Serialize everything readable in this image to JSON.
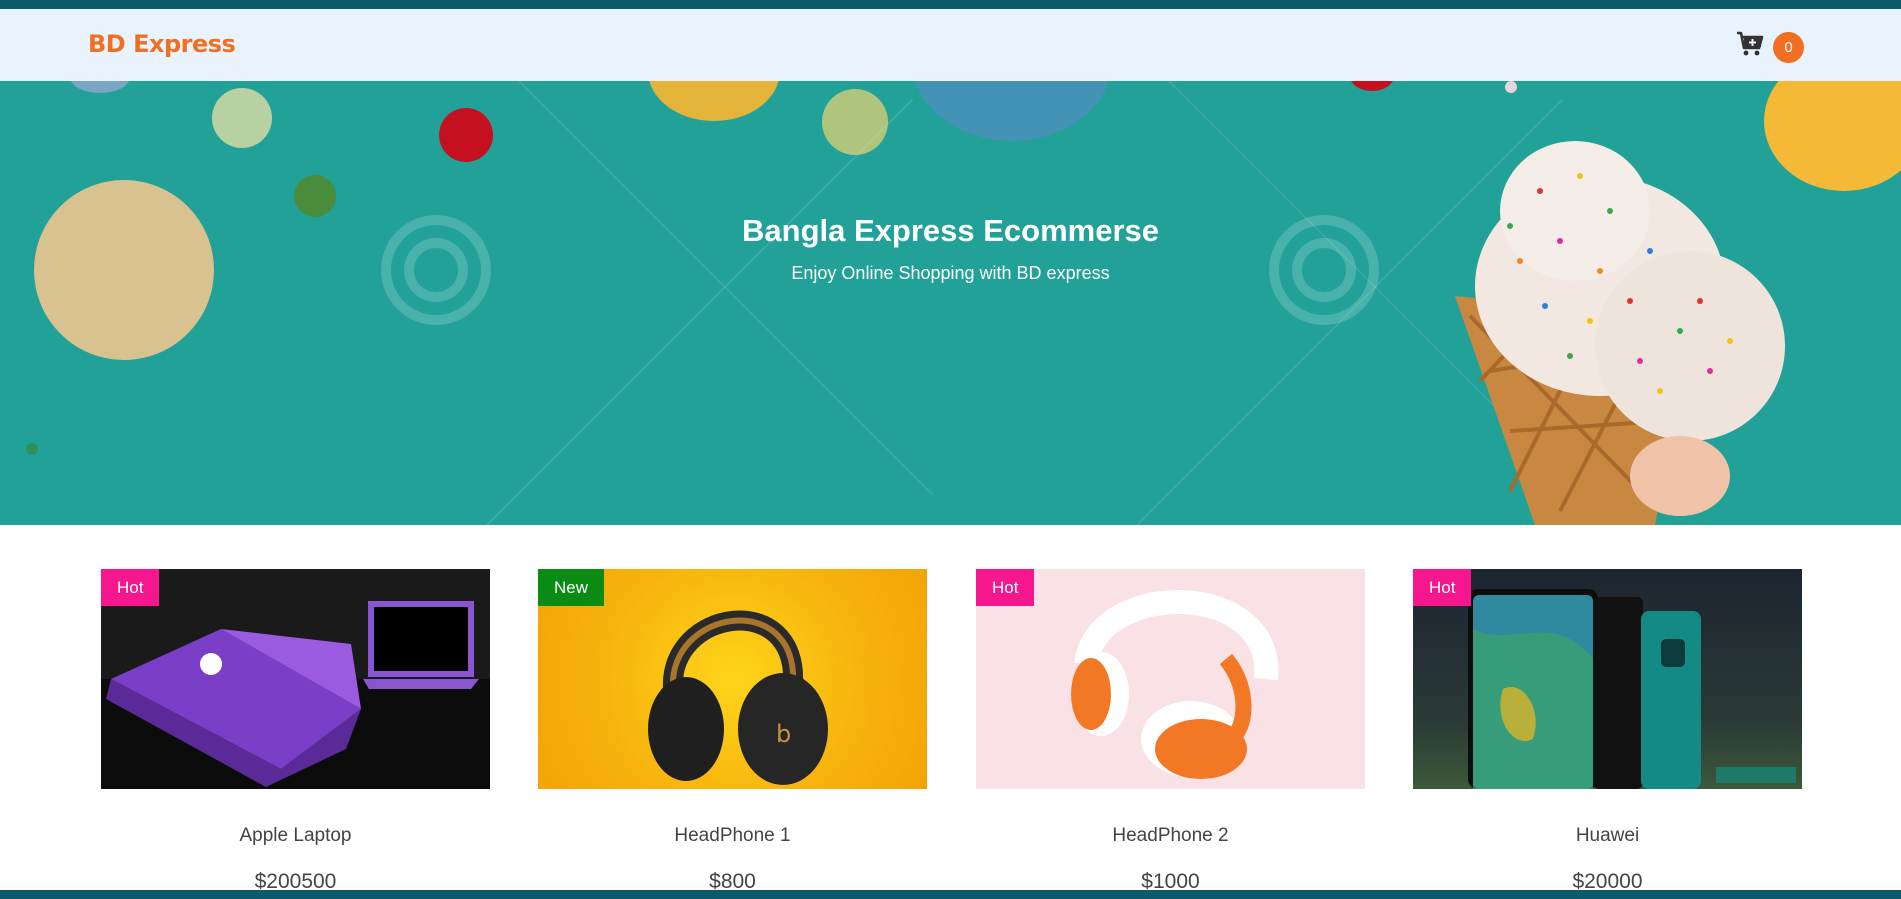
{
  "brand": {
    "name": "BD Express",
    "color": "#f26f21"
  },
  "cart": {
    "icon": "cart-plus-icon",
    "count": "0"
  },
  "hero": {
    "title": "Bangla Express Ecommerse",
    "subtitle": "Enjoy Online Shopping with BD express",
    "background": "#22a198"
  },
  "products": [
    {
      "name": "Apple Laptop",
      "price": "$200500",
      "tag": "Hot"
    },
    {
      "name": "HeadPhone 1",
      "price": "$800",
      "tag": "New"
    },
    {
      "name": "HeadPhone 2",
      "price": "$1000",
      "tag": "Hot"
    },
    {
      "name": "Huawei",
      "price": "$20000",
      "tag": "Hot"
    }
  ],
  "colors": {
    "hot_tag": "#f6178f",
    "new_tag": "#098b14",
    "strip": "#0a5a6b"
  }
}
